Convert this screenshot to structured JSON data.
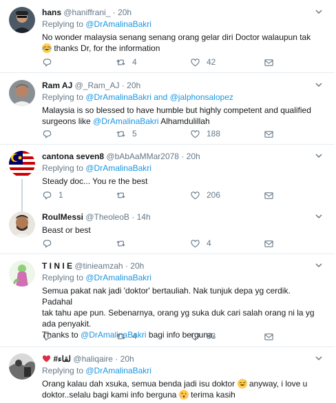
{
  "tweets": [
    {
      "name": "hans",
      "handle": "@haniffrani_",
      "dot": "·",
      "time": "20h",
      "replying_prefix": "Replying to ",
      "replying_to": "@DrAmalinaBakri",
      "body_line1": "No wonder malaysia senang senang orang gelar diri Doctor walaupun tak",
      "body_line2": " thanks Dr, for the information",
      "emoji": "crying-laughing-emoji",
      "reply_count": "",
      "retweet_count": "4",
      "like_count": "42"
    },
    {
      "name": "Ram AJ",
      "handle": "@_Ram_AJ",
      "dot": "·",
      "time": "20h",
      "replying_prefix": "Replying to ",
      "replying_to": "@DrAmalinaBakri",
      "replying_and": " and ",
      "replying_to2": "@jalphonsalopez",
      "body_line1": "Malaysia is so blessed to have humble but highly competent and qualified",
      "body_line2_prefix": "surgeons like ",
      "body_link": "@DrAmalinaBakri",
      "body_line2_suffix": " Alhamdulillah",
      "reply_count": "",
      "retweet_count": "5",
      "like_count": "188"
    },
    {
      "name": "cantona seven8",
      "handle": "@bAbAaMMar2078",
      "dot": "·",
      "time": "20h",
      "replying_prefix": "Replying to ",
      "replying_to": "@DrAmalinaBakri",
      "body_line1": "Steady doc... You re the best",
      "reply_count": "1",
      "retweet_count": "",
      "like_count": "206"
    },
    {
      "name": "RoulMessi",
      "handle": "@TheoleoB",
      "dot": "·",
      "time": "14h",
      "body_line1": "Beast or best",
      "reply_count": "",
      "retweet_count": "",
      "like_count": "4"
    },
    {
      "name": "T I N I E",
      "handle": "@tinieamzah",
      "dot": "·",
      "time": "20h",
      "replying_prefix": "Replying to ",
      "replying_to": "@DrAmalinaBakri",
      "body_line1": "Semua pakat nak jadi 'doktor' bertauliah. Nak tunjuk depa yg cerdik. Padahal",
      "body_line2": "tak tahu ape pun. Sebenarnya, orang yg suka duk cari salah orang ni la yg",
      "body_line3": "ada penyakit.",
      "body_line4_prefix": "Thanks to ",
      "body_link": "@DrAmalinaBakri",
      "body_line4_suffix": " bagi info berguna.",
      "reply_count": "",
      "retweet_count": "4",
      "like_count": "83"
    },
    {
      "name": "#لقاء",
      "handle": "@haliqaire",
      "dot": "·",
      "time": "20h",
      "replying_prefix": "Replying to ",
      "replying_to": "@DrAmalinaBakri",
      "body_line1": "Orang kalau dah xsuka, semua benda jadi isu doktor ",
      "body_line1_suffix": " anyway, i love u",
      "body_line2": "doktor..selalu bagi kami info berguna ",
      "body_line2_suffix": " terima kasih"
    }
  ],
  "colors": {
    "link": "#1b95e0",
    "muted": "#657786",
    "divider": "#e6ecf0",
    "heart": "#e0245e"
  }
}
